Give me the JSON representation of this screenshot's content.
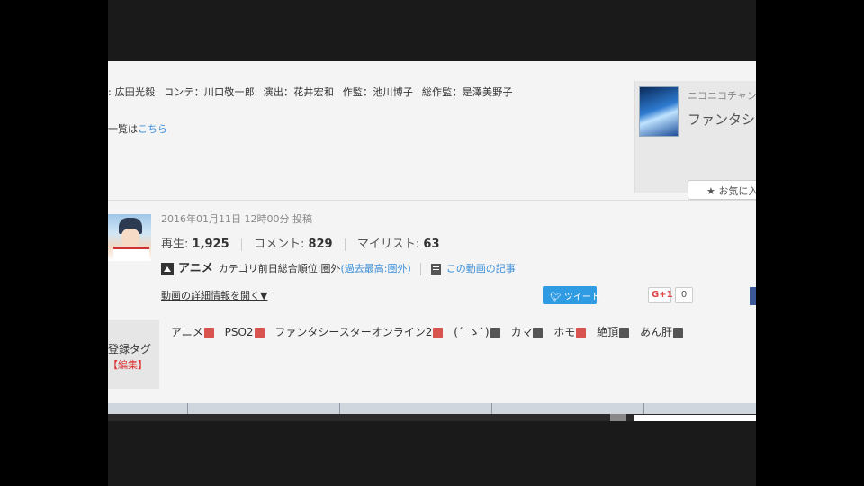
{
  "credits": {
    "items": [
      ": 広田光毅",
      "コンテ：川口敬一郎",
      "演出：花井宏和",
      "作監：池川博子",
      "総作監：是澤美野子"
    ]
  },
  "episode_list": {
    "prefix": "一覧は",
    "link": "こちら"
  },
  "channel": {
    "name": "ニコニコチャン",
    "title": "ファンタシー ジ アニメー",
    "fav_button": "★ お気に入"
  },
  "video": {
    "post_date": "2016年01月11日 12時00分 投稿",
    "views_label": "再生:",
    "views": "1,925",
    "comments_label": "コメント:",
    "comments": "829",
    "mylist_label": "マイリスト:",
    "mylist": "63",
    "category": "アニメ",
    "ranking_text": "カテゴリ前日総合順位:圏外",
    "ranking_link": "(過去最高:圏外)",
    "article_link": "この動画の記事",
    "detail_toggle": "動画の詳細情報を開く▼"
  },
  "social": {
    "tweet": "ツイート",
    "gplus": "G+1",
    "gplus_count": "0"
  },
  "tags_section": {
    "label": "登録タグ",
    "edit": "【編集】",
    "tags": [
      {
        "text": "アニメ",
        "icon": "red"
      },
      {
        "text": "PSO2",
        "icon": "red"
      },
      {
        "text": "ファンタシースターオンライン2",
        "icon": "red"
      },
      {
        "text": "(´_ゝ`)",
        "icon": "gray"
      },
      {
        "text": "カマ",
        "icon": "gray"
      },
      {
        "text": "ホモ",
        "icon": "red"
      },
      {
        "text": "絶頂",
        "icon": "gray"
      },
      {
        "text": "あん肝",
        "icon": "gray"
      }
    ]
  },
  "colors": {
    "link": "#3b8ed8",
    "tweet": "#2f9be3",
    "tag_red": "#d9534f",
    "tag_gray": "#555555"
  }
}
